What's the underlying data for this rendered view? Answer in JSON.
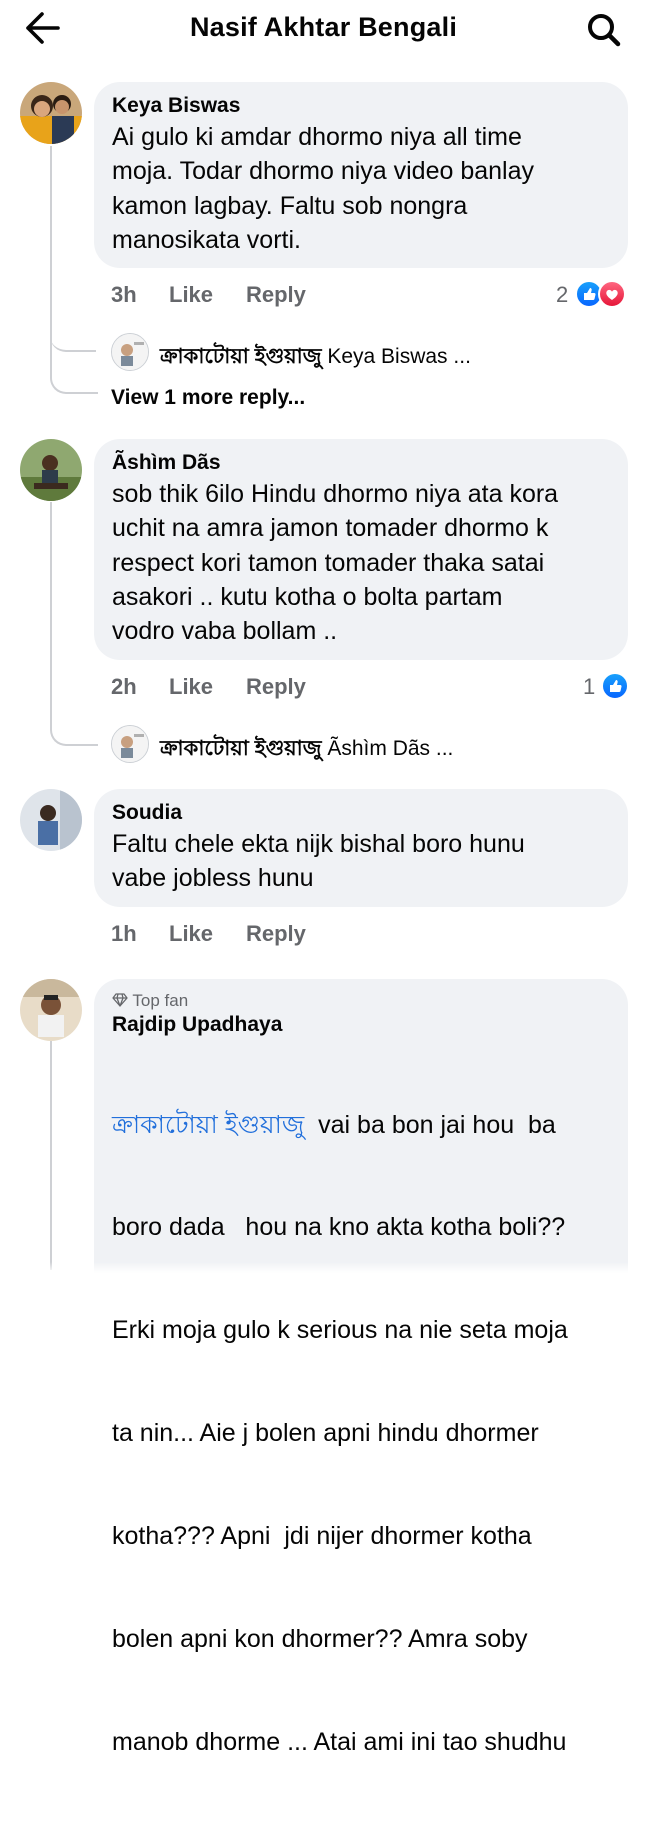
{
  "header": {
    "title": "Nasif Akhtar Bengali",
    "back_icon": "arrow-left-icon",
    "search_icon": "search-icon"
  },
  "comments": [
    {
      "author": "Keya Biswas",
      "lines": [
        "Ai gulo ki amdar dhormo niya all time",
        "moja. Todar dhormo niya video banlay",
        "kamon lagbay. Faltu sob nongra",
        "manosikata vorti."
      ],
      "time": "3h",
      "like": "Like",
      "reply": "Reply",
      "reactions": "2",
      "reaction_icons": [
        "like-icon",
        "love-icon"
      ],
      "reply_preview": {
        "name": "ক্রাকাটোয়া ইগুয়াজু",
        "text": "Keya Biswas ..."
      },
      "view_more": "View 1 more reply..."
    },
    {
      "author": "Ãshìm Dãs",
      "lines": [
        "sob thik 6ilo Hindu dhormo niya ata kora",
        "uchit na amra jamon tomader dhormo k",
        "respect kori tamon tomader thaka satai",
        "asakori .. kutu kotha o bolta partam",
        "vodro vaba bollam .."
      ],
      "time": "2h",
      "like": "Like",
      "reply": "Reply",
      "reactions": "1",
      "reaction_icons": [
        "like-icon"
      ],
      "reply_preview": {
        "name": "ক্রাকাটোয়া ইগুয়াজু",
        "text": "Ãshìm Dãs ..."
      }
    },
    {
      "author": "Soudia",
      "lines": [
        "Faltu chele ekta nijk bishal boro hunu",
        "vabe jobless hunu"
      ],
      "time": "1h",
      "like": "Like",
      "reply": "Reply"
    },
    {
      "badge": "Top fan",
      "author": "Rajdip Upadhaya",
      "mention": "ক্রাকাটোয়া ইগুয়াজু",
      "first_line_rest": "  vai ba bon jai hou  ba",
      "lines": [
        "boro dada   hou na kno akta kotha boli??",
        "Erki moja gulo k serious na nie seta moja",
        "ta nin... Aie j bolen apni hindu dhormer",
        "kotha??? Apni  jdi nijer dhormer kotha",
        "bolen apni kon dhormer?? Amra soby",
        "manob dhorme ... Atai ami ini tao shudhu"
      ]
    }
  ],
  "colors": {
    "accent": "#0866ff",
    "bubble": "#f0f2f5",
    "muted": "#65676b",
    "mention": "#216fdb",
    "love": "#f02849"
  }
}
